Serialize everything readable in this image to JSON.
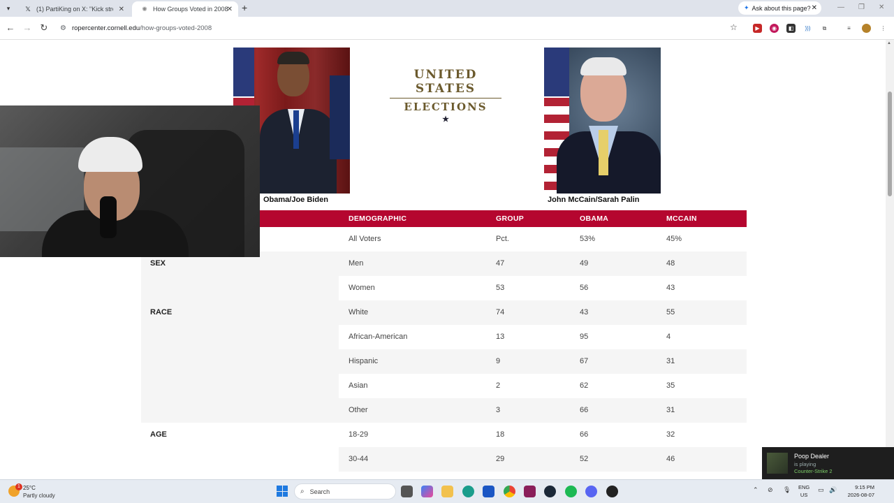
{
  "browser": {
    "tabs": [
      {
        "title": "(1) PartiKing on X: \"Kick stream",
        "favicon": "x-logo",
        "active": false
      },
      {
        "title": "How Groups Voted in 2008 | Ro",
        "favicon": "roper-logo",
        "active": true
      }
    ],
    "new_tab": "+",
    "ask_button": "Ask about this page?",
    "url_domain": "ropercenter.cornell.edu",
    "url_path": "/how-groups-voted-2008"
  },
  "page": {
    "logo_line1": "UNITED STATES",
    "logo_line2": "ELECTIONS",
    "logo_star": "★",
    "caption_left": "Obama/Joe Biden",
    "caption_right": "John McCain/Sarah Palin",
    "table": {
      "headers": [
        "DEMOGRAPHIC",
        "GROUP",
        "OBAMA",
        "MCCAIN"
      ],
      "group_labels": [
        "SEX",
        "RACE",
        "AGE"
      ],
      "rows": [
        {
          "demographic": "All Voters",
          "group": "Pct.",
          "obama": "53%",
          "mccain": "45%"
        },
        {
          "demographic": "Men",
          "group": "47",
          "obama": "49",
          "mccain": "48"
        },
        {
          "demographic": "Women",
          "group": "53",
          "obama": "56",
          "mccain": "43"
        },
        {
          "demographic": "White",
          "group": "74",
          "obama": "43",
          "mccain": "55"
        },
        {
          "demographic": "African-American",
          "group": "13",
          "obama": "95",
          "mccain": "4"
        },
        {
          "demographic": "Hispanic",
          "group": "9",
          "obama": "67",
          "mccain": "31"
        },
        {
          "demographic": "Asian",
          "group": "2",
          "obama": "62",
          "mccain": "35"
        },
        {
          "demographic": "Other",
          "group": "3",
          "obama": "66",
          "mccain": "31"
        },
        {
          "demographic": "18-29",
          "group": "18",
          "obama": "66",
          "mccain": "32"
        },
        {
          "demographic": "30-44",
          "group": "29",
          "obama": "52",
          "mccain": "46"
        }
      ]
    }
  },
  "notification": {
    "name": "Poop Dealer",
    "status": "is playing",
    "game": "Counter-Strike 2"
  },
  "taskbar": {
    "weather_badge": "1",
    "temperature": "25°C",
    "condition": "Partly cloudy",
    "search_placeholder": "Search",
    "lang1": "ENG",
    "lang2": "US",
    "time": "9:15 PM",
    "date": "2026-08-07"
  },
  "colors": {
    "table_header": "#b5062f",
    "logo_gold": "#6b5a2d"
  }
}
